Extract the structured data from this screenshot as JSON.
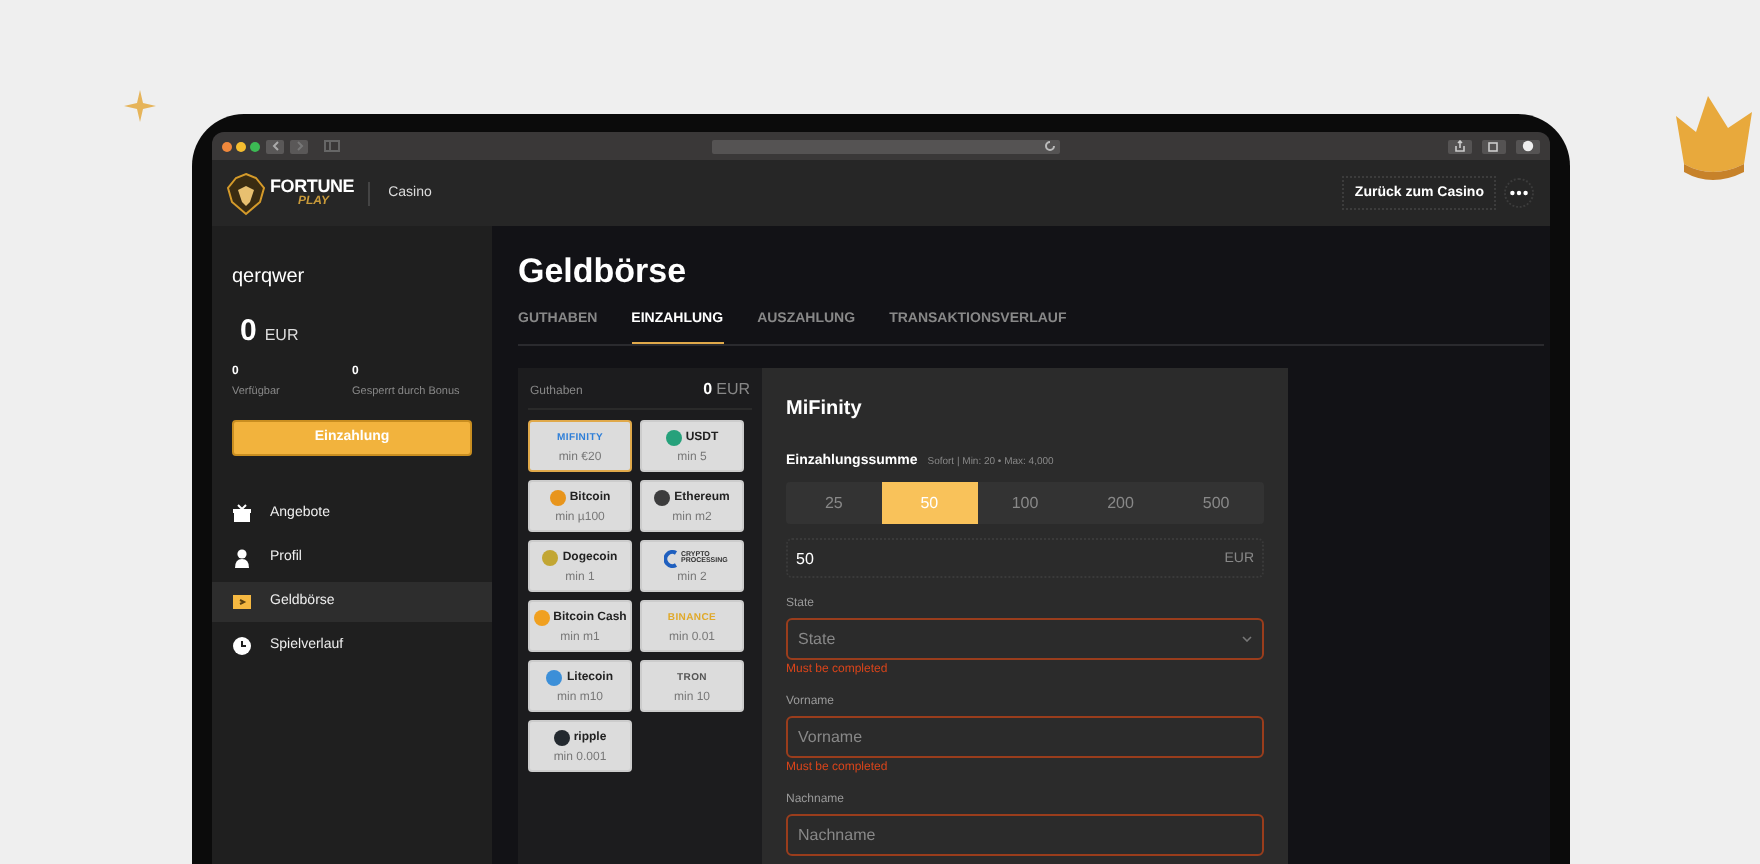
{
  "header": {
    "logo_top": "FORTUNE",
    "logo_bottom": "PLAY",
    "section": "Casino",
    "back_button": "Zurück zum Casino"
  },
  "sidebar": {
    "username": "qerqwer",
    "balance": "0",
    "currency": "EUR",
    "stats": [
      {
        "value": "0",
        "label": "Verfügbar"
      },
      {
        "value": "0",
        "label": "Gesperrt durch Bonus"
      }
    ],
    "deposit_button": "Einzahlung",
    "menu": [
      {
        "label": "Angebote",
        "kind": "gift",
        "selected": false
      },
      {
        "label": "Profil",
        "kind": "user",
        "selected": false
      },
      {
        "label": "Geldbörse",
        "kind": "wallet",
        "selected": true
      },
      {
        "label": "Spielverlauf",
        "kind": "clock",
        "selected": false
      }
    ]
  },
  "wallet": {
    "title": "Geldbörse",
    "tabs": [
      {
        "label": "GUTHABEN",
        "selected": false
      },
      {
        "label": "EINZAHLUNG",
        "selected": true
      },
      {
        "label": "AUSZAHLUNG",
        "selected": false
      },
      {
        "label": "TRANSAKTIONSVERLAUF",
        "selected": false
      }
    ],
    "methods_panel": {
      "balance_label": "Guthaben",
      "balance": "0",
      "currency": "EUR",
      "methods": [
        {
          "kind": "wordmark",
          "label": "MIFINITY",
          "min": "min €20",
          "selected": true,
          "color": "#2f7fd8"
        },
        {
          "kind": "coin",
          "label": "USDT",
          "min": "min 5",
          "selected": false,
          "color": "#26a17b"
        },
        {
          "kind": "coin",
          "label": "Bitcoin",
          "min": "min µ100",
          "selected": false,
          "color": "#e8951c"
        },
        {
          "kind": "coin",
          "label": "Ethereum",
          "min": "min m2",
          "selected": false,
          "color": "#3c3c3d"
        },
        {
          "kind": "coin",
          "label": "Dogecoin",
          "min": "min 1",
          "selected": false,
          "color": "#c2a633"
        },
        {
          "kind": "stacked",
          "label": "CRYPTO PROCESSING",
          "min": "min 2",
          "selected": false,
          "color": "#1f5fbf"
        },
        {
          "kind": "coin",
          "label": "Bitcoin Cash",
          "min": "min m1",
          "selected": false,
          "color": "#f0a020"
        },
        {
          "kind": "wordmark",
          "label": "BINANCE",
          "min": "min 0.01",
          "selected": false,
          "color": "#e0a92a"
        },
        {
          "kind": "coin",
          "label": "Litecoin",
          "min": "min m10",
          "selected": false,
          "color": "#3c8fd8"
        },
        {
          "kind": "wordmark",
          "label": "TRON",
          "min": "min 10",
          "selected": false,
          "color": "#555555"
        },
        {
          "kind": "coin",
          "label": "ripple",
          "min": "min 0.001",
          "selected": false,
          "color": "#23292f"
        }
      ]
    }
  },
  "form": {
    "title": "MiFinity",
    "amount_label": "Einzahlungssumme",
    "amount_hint": "Sofort | Min: 20 • Max: 4,000",
    "presets": [
      {
        "label": "25",
        "selected": false
      },
      {
        "label": "50",
        "selected": true
      },
      {
        "label": "100",
        "selected": false
      },
      {
        "label": "200",
        "selected": false
      },
      {
        "label": "500",
        "selected": false
      }
    ],
    "amount": {
      "value": "50",
      "currency": "EUR"
    },
    "fields": [
      {
        "kind": "select",
        "label": "State",
        "placeholder": "State",
        "invalid": true,
        "error": "Must be completed"
      },
      {
        "kind": "text",
        "label": "Vorname",
        "placeholder": "Vorname",
        "invalid": true,
        "error": "Must be completed"
      },
      {
        "kind": "text",
        "label": "Nachname",
        "placeholder": "Nachname",
        "invalid": true
      }
    ]
  }
}
